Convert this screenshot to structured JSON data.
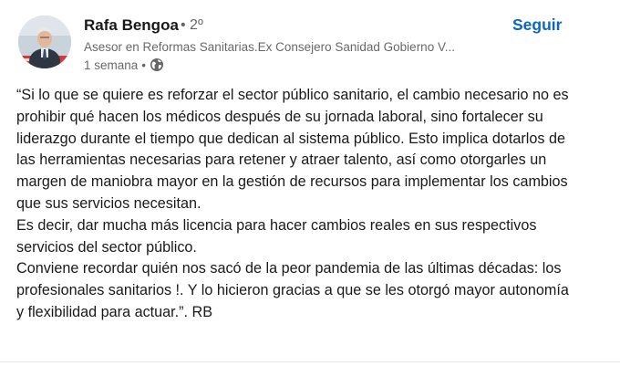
{
  "author": {
    "name": "Rafa Bengoa",
    "degree": "• 2º",
    "headline": "Asesor en Reformas Sanitarias.Ex Consejero Sanidad Gobierno V...",
    "time": "1 semana",
    "separator": "•",
    "visibility_icon": "globe-icon"
  },
  "actions": {
    "follow_label": "Seguir"
  },
  "colors": {
    "follow": "#0a66c2",
    "text_primary": "#191919",
    "text_secondary": "#666666"
  },
  "post": {
    "lines": [
      "“Si lo que se quiere es reforzar el sector público sanitario, el cambio necesario no es",
      "prohibir qué hacen los médicos después de su jornada laboral, sino fortalecer su",
      "liderazgo durante el tiempo que dedican al sistema público. Esto implica dotarlos de",
      "las herramientas necesarias para retener y atraer talento, así como otorgarles un",
      "margen de maniobra mayor en la gestión de recursos para implementar los cambios",
      "que sus servicios necesitan.",
      "Es decir, dar mucha más licencia para hacer cambios reales en sus respectivos",
      "servicios del sector público.",
      "Conviene recordar quién nos sacó de la peor pandemia de las últimas décadas: los",
      "profesionales sanitarios !. Y lo hicieron gracias a que se les otorgó mayor autonomía",
      "y flexibilidad para actuar.”. RB"
    ]
  }
}
